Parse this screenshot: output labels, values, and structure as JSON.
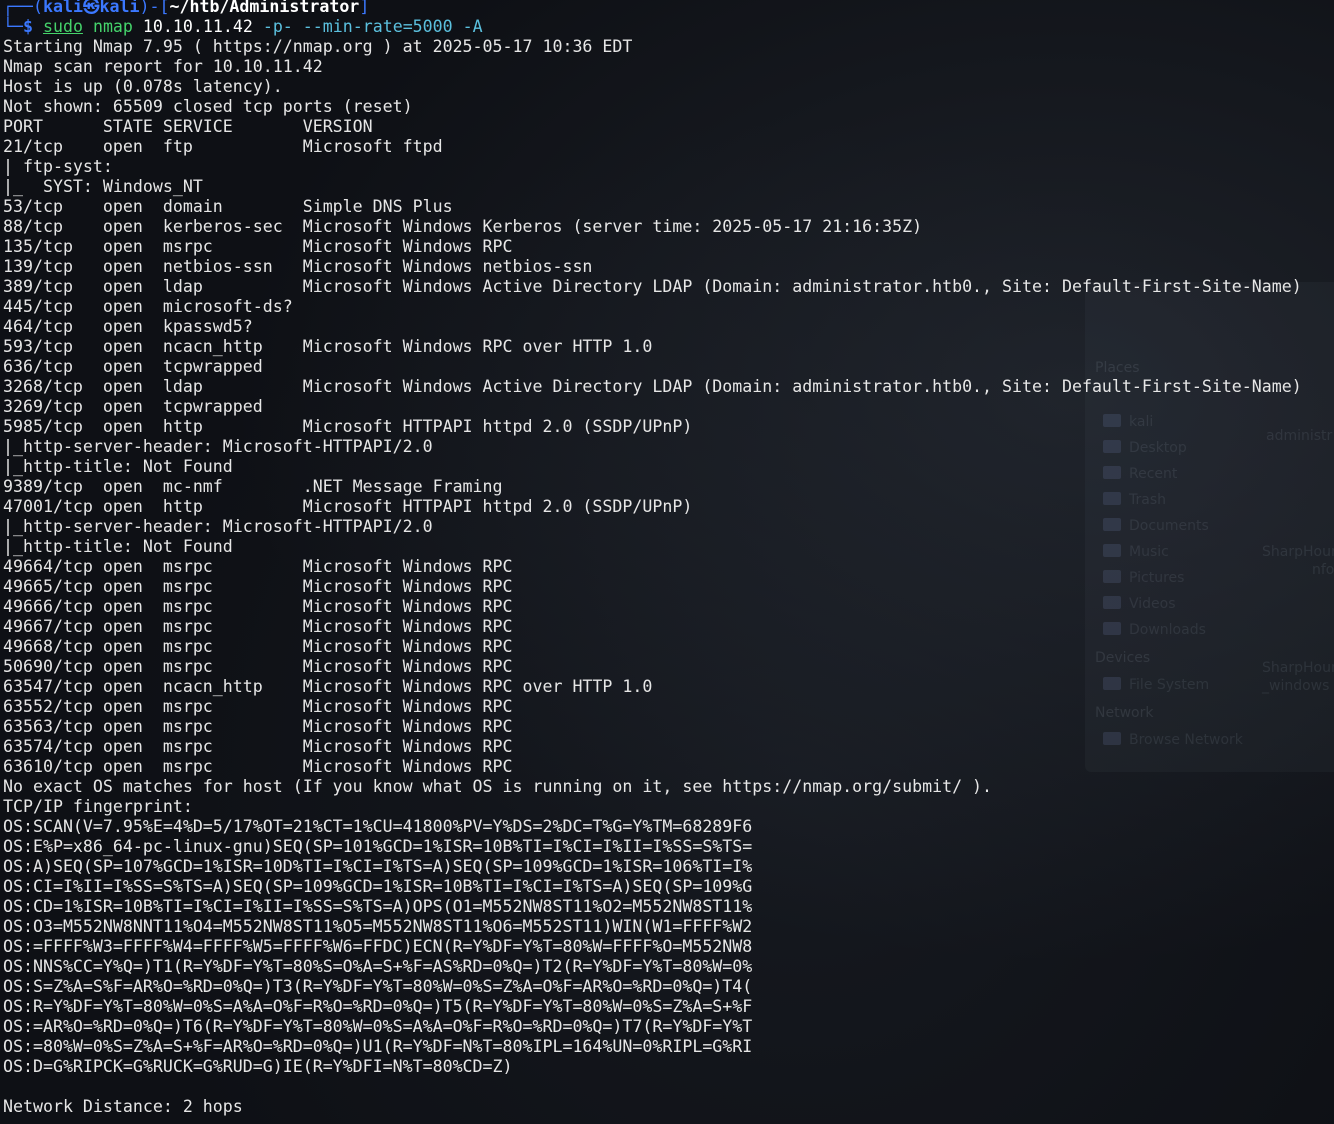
{
  "background_window": {
    "sections": {
      "places": "Places",
      "devices": "Devices",
      "network": "Network"
    },
    "places_items": [
      "kali",
      "Desktop",
      "Recent",
      "Trash",
      "Documents",
      "Music",
      "Pictures",
      "Videos",
      "Downloads"
    ],
    "devices_items": [
      "File System"
    ],
    "network_items": [
      "Browse Network"
    ],
    "side_fragments": [
      "administr",
      "SharpHoun",
      "nfo",
      "SharpHoun",
      "_windows"
    ]
  },
  "prompt": {
    "frame_open": "┌──(",
    "user": "kali",
    "skull": "㉿",
    "host": "kali",
    "frame_mid": ")-[",
    "path": "~/htb/Administrator",
    "frame_close": "]",
    "second_line_frame": "└─",
    "dollar": "$",
    "sudo": "sudo",
    "program": "nmap",
    "target": "10.10.11.42",
    "options": "-p- --min-rate=5000 -A"
  },
  "output_lines": [
    "Starting Nmap 7.95 ( https://nmap.org ) at 2025-05-17 10:36 EDT",
    "Nmap scan report for 10.10.11.42",
    "Host is up (0.078s latency).",
    "Not shown: 65509 closed tcp ports (reset)",
    "PORT      STATE SERVICE       VERSION",
    "21/tcp    open  ftp           Microsoft ftpd",
    "| ftp-syst:",
    "|_  SYST: Windows_NT",
    "53/tcp    open  domain        Simple DNS Plus",
    "88/tcp    open  kerberos-sec  Microsoft Windows Kerberos (server time: 2025-05-17 21:16:35Z)",
    "135/tcp   open  msrpc         Microsoft Windows RPC",
    "139/tcp   open  netbios-ssn   Microsoft Windows netbios-ssn",
    "389/tcp   open  ldap          Microsoft Windows Active Directory LDAP (Domain: administrator.htb0., Site: Default-First-Site-Name)",
    "445/tcp   open  microsoft-ds?",
    "464/tcp   open  kpasswd5?",
    "593/tcp   open  ncacn_http    Microsoft Windows RPC over HTTP 1.0",
    "636/tcp   open  tcpwrapped",
    "3268/tcp  open  ldap          Microsoft Windows Active Directory LDAP (Domain: administrator.htb0., Site: Default-First-Site-Name)",
    "3269/tcp  open  tcpwrapped",
    "5985/tcp  open  http          Microsoft HTTPAPI httpd 2.0 (SSDP/UPnP)",
    "|_http-server-header: Microsoft-HTTPAPI/2.0",
    "|_http-title: Not Found",
    "9389/tcp  open  mc-nmf        .NET Message Framing",
    "47001/tcp open  http          Microsoft HTTPAPI httpd 2.0 (SSDP/UPnP)",
    "|_http-server-header: Microsoft-HTTPAPI/2.0",
    "|_http-title: Not Found",
    "49664/tcp open  msrpc         Microsoft Windows RPC",
    "49665/tcp open  msrpc         Microsoft Windows RPC",
    "49666/tcp open  msrpc         Microsoft Windows RPC",
    "49667/tcp open  msrpc         Microsoft Windows RPC",
    "49668/tcp open  msrpc         Microsoft Windows RPC",
    "50690/tcp open  msrpc         Microsoft Windows RPC",
    "63547/tcp open  ncacn_http    Microsoft Windows RPC over HTTP 1.0",
    "63552/tcp open  msrpc         Microsoft Windows RPC",
    "63563/tcp open  msrpc         Microsoft Windows RPC",
    "63574/tcp open  msrpc         Microsoft Windows RPC",
    "63610/tcp open  msrpc         Microsoft Windows RPC",
    "No exact OS matches for host (If you know what OS is running on it, see https://nmap.org/submit/ ).",
    "TCP/IP fingerprint:",
    "OS:SCAN(V=7.95%E=4%D=5/17%OT=21%CT=1%CU=41800%PV=Y%DS=2%DC=T%G=Y%TM=68289F6",
    "OS:E%P=x86_64-pc-linux-gnu)SEQ(SP=101%GCD=1%ISR=10B%TI=I%CI=I%II=I%SS=S%TS=",
    "OS:A)SEQ(SP=107%GCD=1%ISR=10D%TI=I%CI=I%TS=A)SEQ(SP=109%GCD=1%ISR=106%TI=I%",
    "OS:CI=I%II=I%SS=S%TS=A)SEQ(SP=109%GCD=1%ISR=10B%TI=I%CI=I%TS=A)SEQ(SP=109%G",
    "OS:CD=1%ISR=10B%TI=I%CI=I%II=I%SS=S%TS=A)OPS(O1=M552NW8ST11%O2=M552NW8ST11%",
    "OS:O3=M552NW8NNT11%O4=M552NW8ST11%O5=M552NW8ST11%O6=M552ST11)WIN(W1=FFFF%W2",
    "OS:=FFFF%W3=FFFF%W4=FFFF%W5=FFFF%W6=FFDC)ECN(R=Y%DF=Y%T=80%W=FFFF%O=M552NW8",
    "OS:NNS%CC=Y%Q=)T1(R=Y%DF=Y%T=80%S=O%A=S+%F=AS%RD=0%Q=)T2(R=Y%DF=Y%T=80%W=0%",
    "OS:S=Z%A=S%F=AR%O=%RD=0%Q=)T3(R=Y%DF=Y%T=80%W=0%S=Z%A=O%F=AR%O=%RD=0%Q=)T4(",
    "OS:R=Y%DF=Y%T=80%W=0%S=A%A=O%F=R%O=%RD=0%Q=)T5(R=Y%DF=Y%T=80%W=0%S=Z%A=S+%F",
    "OS:=AR%O=%RD=0%Q=)T6(R=Y%DF=Y%T=80%W=0%S=A%A=O%F=R%O=%RD=0%Q=)T7(R=Y%DF=Y%T",
    "OS:=80%W=0%S=Z%A=S+%F=AR%O=%RD=0%Q=)U1(R=Y%DF=N%T=80%IPL=164%UN=0%RIPL=G%RI",
    "OS:D=G%RIPCK=G%RUCK=G%RUD=G)IE(R=Y%DFI=N%T=80%CD=Z)",
    "",
    "Network Distance: 2 hops"
  ],
  "colors": {
    "background": "#0e1015",
    "text": "#e6e6e6",
    "prompt_blue": "#3b78ff",
    "command_green": "#45d36b",
    "option_cyan": "#5bc0de"
  }
}
